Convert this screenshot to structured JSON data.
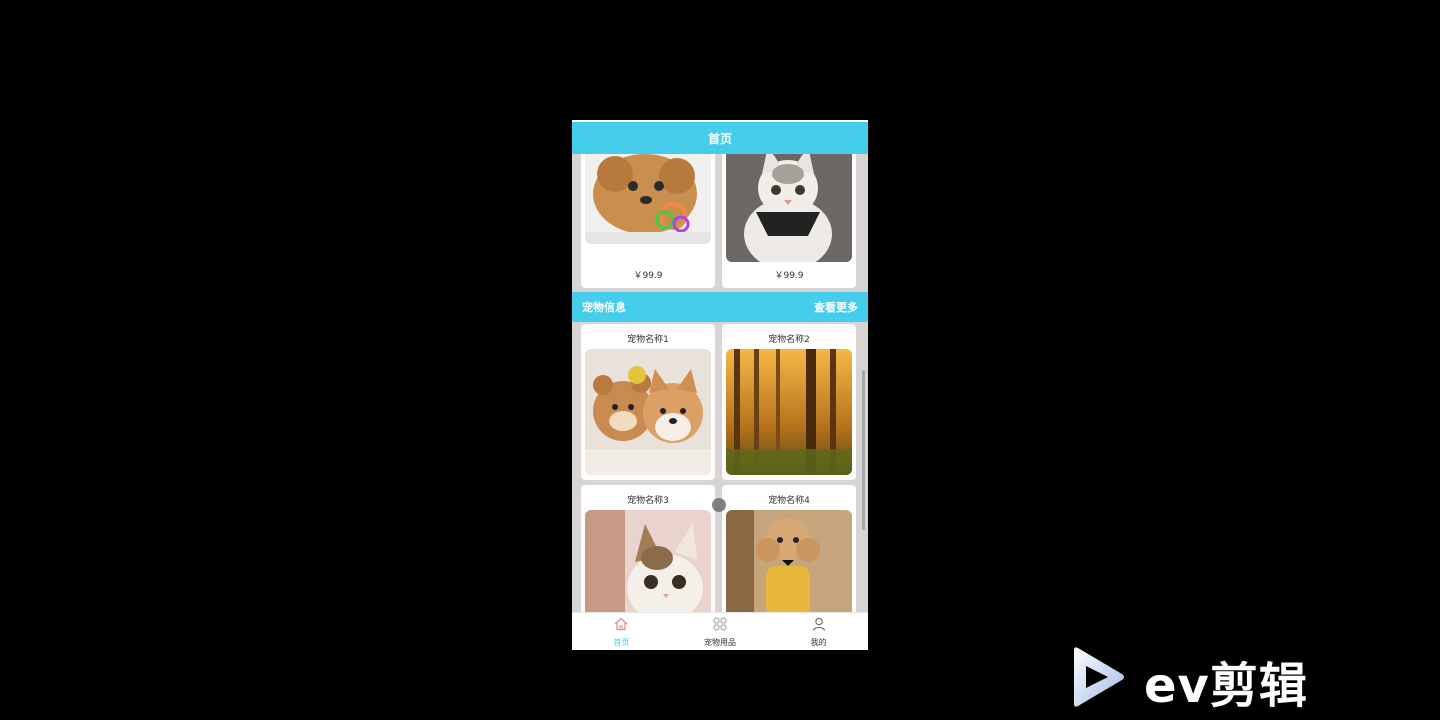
{
  "header": {
    "title": "首页"
  },
  "products": [
    {
      "price": "￥99.9"
    },
    {
      "price": "￥99.9"
    }
  ],
  "pet_section": {
    "title": "宠物信息",
    "more_label": "查看更多"
  },
  "pets": [
    {
      "name": "宠物名称1"
    },
    {
      "name": "宠物名称2"
    },
    {
      "name": "宠物名称3"
    },
    {
      "name": "宠物名称4"
    }
  ],
  "tabbar": {
    "items": [
      {
        "label": "首页",
        "icon": "home-icon",
        "active": true
      },
      {
        "label": "宠物用品",
        "icon": "grid-icon",
        "active": false
      },
      {
        "label": "我的",
        "icon": "user-icon",
        "active": false
      }
    ]
  },
  "watermark": {
    "text": "ev剪辑"
  },
  "colors": {
    "accent": "#45cdec",
    "background": "#000000",
    "page_bg": "#d8d4d4"
  }
}
